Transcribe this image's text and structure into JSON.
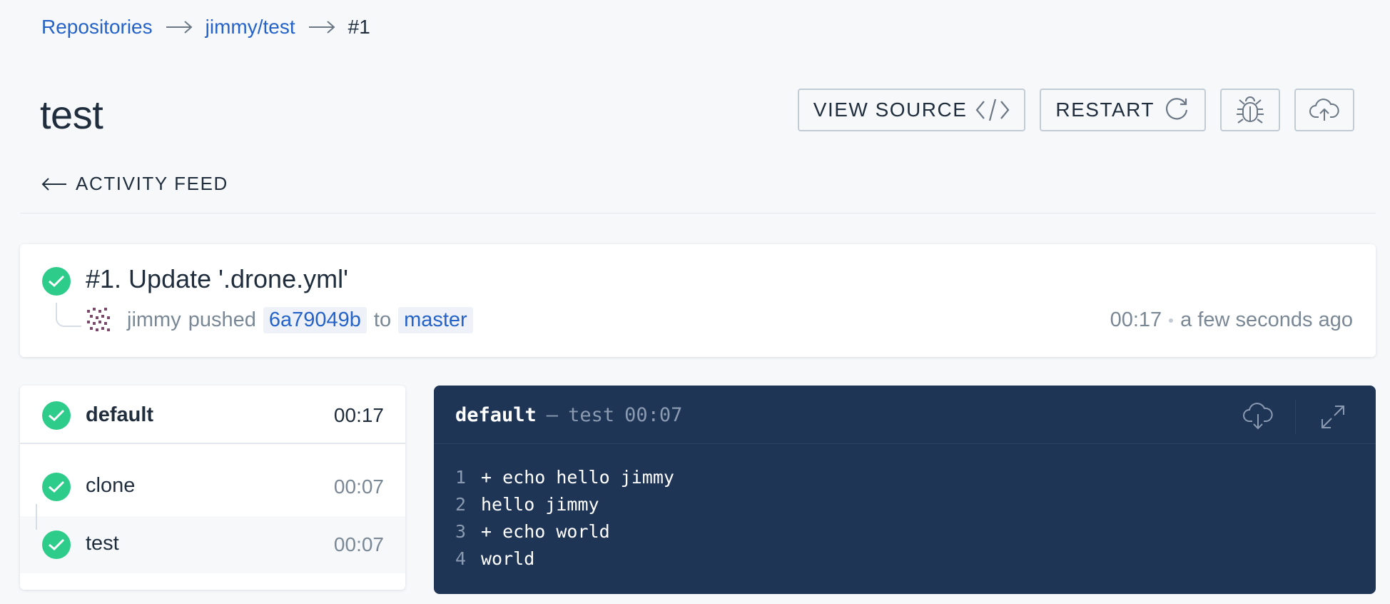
{
  "breadcrumb": {
    "items": [
      "Repositories",
      "jimmy/test"
    ],
    "current": "#1"
  },
  "page": {
    "title": "test"
  },
  "toolbar": {
    "view_source_label": "VIEW SOURCE",
    "restart_label": "RESTART",
    "debug_icon": "bug-icon",
    "promote_icon": "cloud-upload-icon"
  },
  "nav": {
    "activity_feed_label": "ACTIVITY FEED"
  },
  "build": {
    "title": "#1. Update '.drone.yml'",
    "author": "jimmy",
    "action": "pushed",
    "commit": "6a79049b",
    "preposition": "to",
    "branch": "master",
    "duration": "00:17",
    "time_ago": "a few seconds ago",
    "status": "success"
  },
  "stage": {
    "name": "default",
    "duration": "00:17",
    "steps": [
      {
        "name": "clone",
        "duration": "00:07"
      },
      {
        "name": "test",
        "duration": "00:07"
      }
    ]
  },
  "log": {
    "stage": "default",
    "separator": "—",
    "step": "test",
    "duration": "00:07",
    "lines": [
      {
        "num": "1",
        "text": "+ echo hello jimmy"
      },
      {
        "num": "2",
        "text": "hello jimmy"
      },
      {
        "num": "3",
        "text": "+ echo world"
      },
      {
        "num": "4",
        "text": "world"
      }
    ]
  },
  "colors": {
    "accent": "#2563c9",
    "success": "#2ecc8a",
    "log_background": "#1f3556",
    "page_background": "#f6f8fa"
  }
}
